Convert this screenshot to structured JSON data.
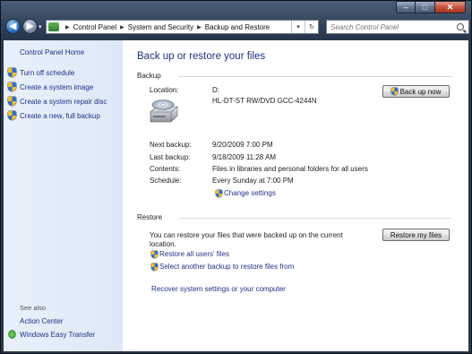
{
  "window": {
    "caption": {
      "minimize": "–",
      "maximize": "□",
      "close": "✕"
    }
  },
  "navbar": {
    "back": "◀",
    "forward": "▶",
    "dropdown": "▾",
    "breadcrumb": [
      "Control Panel",
      "System and Security",
      "Backup and Restore"
    ],
    "separator": "▶",
    "address_dropdown": "▾",
    "refresh": "↻",
    "search_placeholder": "Search Control Panel"
  },
  "sidebar": {
    "home": "Control Panel Home",
    "tasks": [
      {
        "label": "Turn off schedule",
        "icon": "shield-icon"
      },
      {
        "label": "Create a system image",
        "icon": "shield-icon"
      },
      {
        "label": "Create a system repair disc",
        "icon": "shield-icon"
      },
      {
        "label": "Create a new, full backup",
        "icon": "shield-icon"
      }
    ],
    "see_also": "See also",
    "see_also_links": [
      {
        "label": "Action Center"
      },
      {
        "label": "Windows Easy Transfer",
        "icon": "transfer-icon"
      }
    ]
  },
  "main": {
    "title": "Back up or restore your files",
    "backup": {
      "heading": "Backup",
      "location_label": "Location:",
      "location_drive": "D:",
      "location_device": "HL-DT-ST RW/DVD GCC-4244N",
      "backup_now_label": "Back up now",
      "next_backup_label": "Next backup:",
      "next_backup_value": "9/20/2009 7:00 PM",
      "last_backup_label": "Last backup:",
      "last_backup_value": "9/18/2009 11:28 AM",
      "contents_label": "Contents:",
      "contents_value": "Files in libraries and personal folders for all users",
      "schedule_label": "Schedule:",
      "schedule_value": "Every Sunday at 7:00 PM",
      "change_settings": "Change settings"
    },
    "restore": {
      "heading": "Restore",
      "description": "You can restore your files that were backed up on the current location.",
      "restore_my_files_label": "Restore my files",
      "restore_all_users": "Restore all users' files",
      "select_another": "Select another backup to restore files from",
      "recover_system": "Recover system settings or your computer"
    }
  }
}
